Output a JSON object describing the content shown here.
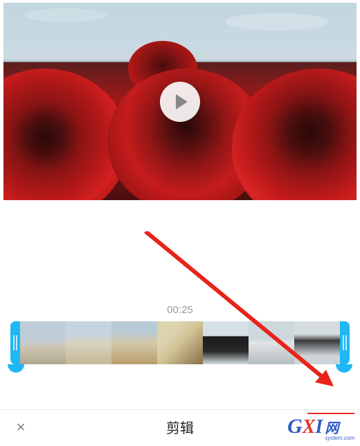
{
  "preview": {
    "play_icon_name": "play-icon"
  },
  "editor": {
    "time": "00:25",
    "title": "剪辑",
    "close_label": "×"
  },
  "watermark": {
    "g": "G",
    "x": "X",
    "i": "I",
    "wang": "网",
    "domain": "system.com"
  }
}
